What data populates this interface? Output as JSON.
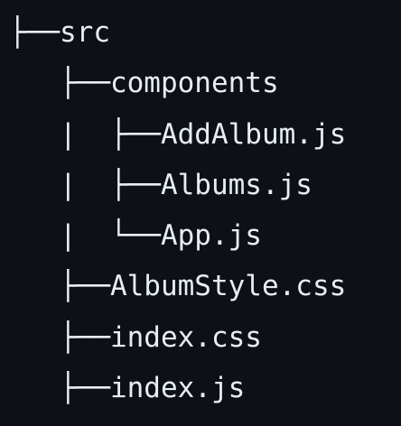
{
  "tree": {
    "lines": [
      "├──src",
      "   ├──components",
      "   |  ├──AddAlbum.js",
      "   |  ├──Albums.js",
      "   |  └──App.js",
      "   ├──AlbumStyle.css",
      "   ├──index.css",
      "   ├──index.js"
    ]
  }
}
